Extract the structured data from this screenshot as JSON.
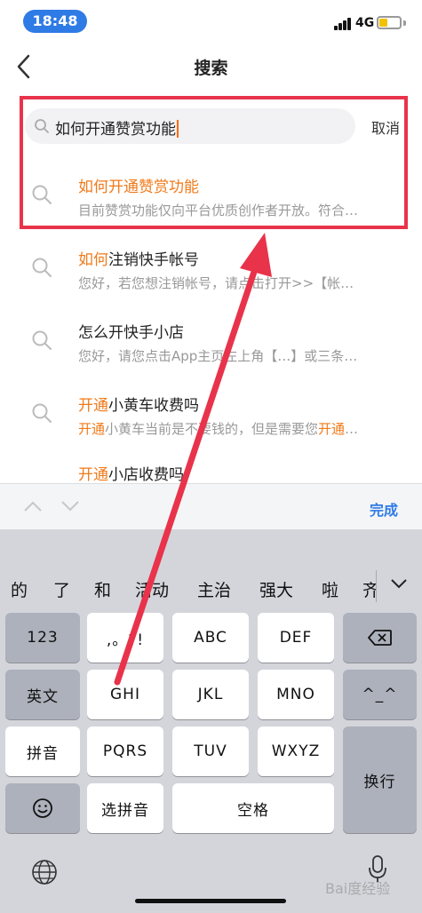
{
  "status": {
    "time": "18:48",
    "network": "4G",
    "battery_level": 0.4
  },
  "nav": {
    "title": "搜索"
  },
  "search": {
    "value": "如何开通赞赏功能",
    "cancel_label": "取消"
  },
  "suggestions": [
    {
      "title_hl": "如何开通赞赏功能",
      "title_rest": "",
      "desc_hl": "",
      "desc_rest": "目前赞赏功能仅向平台优质创作者开放。符合…"
    },
    {
      "title_hl": "如何",
      "title_rest": "注销快手帐号",
      "desc_hl": "",
      "desc_rest": "您好，若您想注销帐号，请点击打开>>【帐…"
    },
    {
      "title_hl": "",
      "title_rest": "怎么开快手小店",
      "desc_hl": "",
      "desc_rest": "您好，请您点击App主页左上角【…】或三条…"
    },
    {
      "title_hl": "开通",
      "title_rest": "小黄车收费吗",
      "desc_hl": "开通",
      "desc_rest": "小黄车当前是不要钱的，但是需要您",
      "desc_hl2": "开通",
      "desc_tail": "…"
    },
    {
      "title_hl": "开通",
      "title_rest": "小店收费吗",
      "desc_hl": "",
      "desc_rest": ""
    }
  ],
  "accessory": {
    "done_label": "完成"
  },
  "keyboard": {
    "candidates": [
      "的",
      "了",
      "和",
      "活动",
      "主治",
      "强大",
      "啦",
      "齐"
    ],
    "rows": [
      [
        "123",
        ",。?!",
        "ABC",
        "DEF",
        "delete"
      ],
      [
        "英文",
        "GHI",
        "JKL",
        "MNO",
        "^^"
      ],
      [
        "拼音",
        "PQRS",
        "TUV",
        "WXYZ",
        "换行"
      ],
      [
        "emoji",
        "选拼音",
        "空格"
      ]
    ],
    "labels": {
      "num": "123",
      "punct": ",。?!",
      "abc": "ABC",
      "def": "DEF",
      "english": "英文",
      "ghi": "GHI",
      "jkl": "JKL",
      "mno": "MNO",
      "face": "^_^",
      "pinyin": "拼音",
      "pqrs": "PQRS",
      "tuv": "TUV",
      "wxyz": "WXYZ",
      "newline": "换行",
      "select_pinyin": "选拼音",
      "space": "空格"
    }
  },
  "watermark": "Bai度经验",
  "colors": {
    "accent": "#2f7be6",
    "highlight": "#f07a1a",
    "annotation": "#e8334b"
  }
}
